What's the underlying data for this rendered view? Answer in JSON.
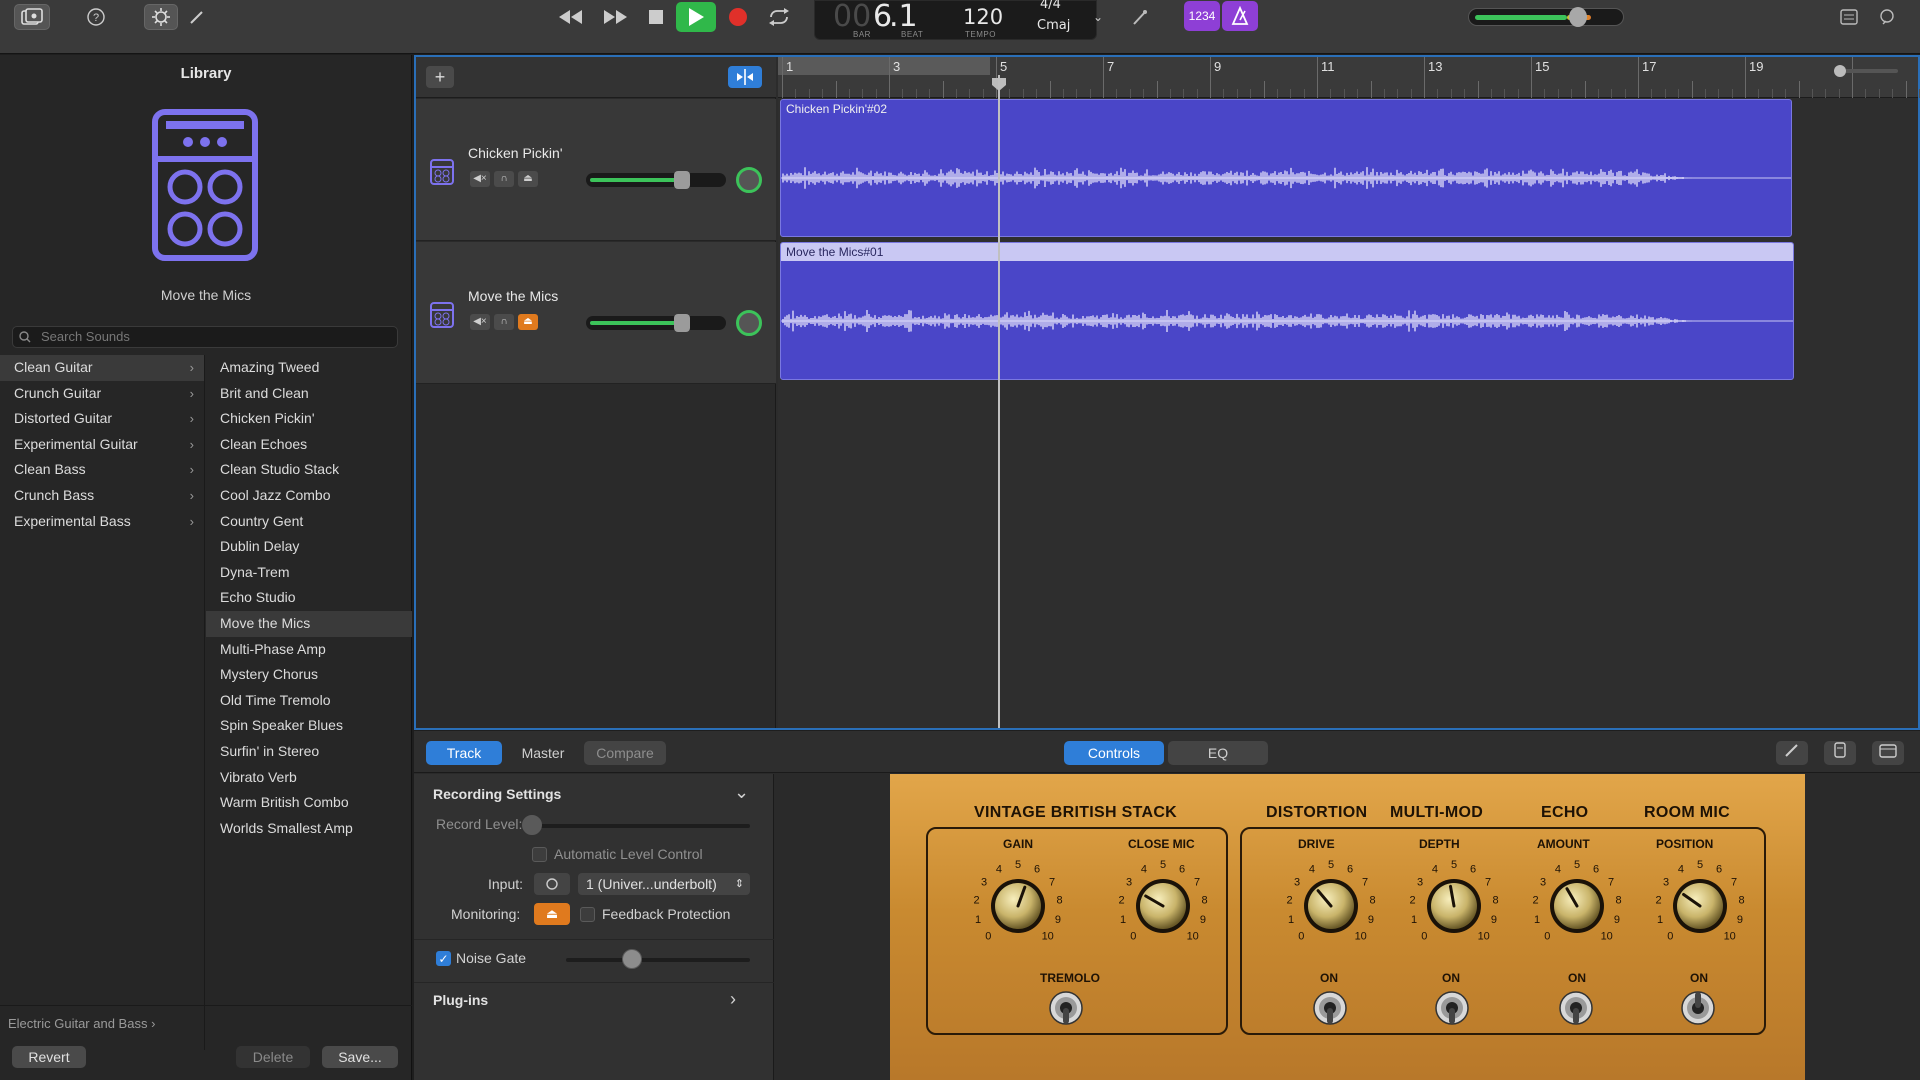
{
  "toolbar": {
    "lcd": {
      "bar": "6",
      "beat": ".1",
      "bar_prefix": "00",
      "bar_label": "BAR",
      "beat_label": "BEAT",
      "tempo": "120",
      "tempo_label": "TEMPO",
      "signature": "4/4",
      "key": "Cmaj"
    },
    "count_in": "1234",
    "master_volume": 0.68,
    "colors": {
      "play": "#30b84a",
      "record": "#e0302a",
      "purple": "#8e3fd6"
    }
  },
  "library": {
    "title": "Library",
    "selected_patch": "Move the Mics",
    "search_placeholder": "Search Sounds",
    "categories": [
      {
        "label": "Clean Guitar",
        "selected": true
      },
      {
        "label": "Crunch Guitar"
      },
      {
        "label": "Distorted Guitar"
      },
      {
        "label": "Experimental Guitar"
      },
      {
        "label": "Clean Bass"
      },
      {
        "label": "Crunch Bass"
      },
      {
        "label": "Experimental Bass"
      }
    ],
    "patches": [
      "Amazing Tweed",
      "Brit and Clean",
      "Chicken Pickin'",
      "Clean Echoes",
      "Clean Studio Stack",
      "Cool Jazz Combo",
      "Country Gent",
      "Dublin Delay",
      "Dyna-Trem",
      "Echo Studio",
      "Move the Mics",
      "Multi-Phase Amp",
      "Mystery Chorus",
      "Old Time Tremolo",
      "Spin Speaker Blues",
      "Surfin' in Stereo",
      "Vibrato Verb",
      "Warm British Combo",
      "Worlds Smallest Amp"
    ],
    "footer": {
      "breadcrumb": "Electric Guitar and Bass",
      "revert": "Revert",
      "delete": "Delete",
      "save": "Save..."
    }
  },
  "tracks": [
    {
      "name": "Chicken Pickin'",
      "volume": 0.72,
      "region": "Chicken Pickin'#02"
    },
    {
      "name": "Move the Mics",
      "volume": 0.72,
      "region": "Move the Mics#01"
    }
  ],
  "ruler": {
    "bars": [
      "1",
      "3",
      "5",
      "7",
      "9",
      "11",
      "13",
      "15",
      "17",
      "19"
    ]
  },
  "smart_controls": {
    "tabs_left": [
      "Track",
      "Master",
      "Compare"
    ],
    "tabs_center": [
      "Controls",
      "EQ"
    ],
    "recording": {
      "title": "Recording Settings",
      "record_level": "Record Level:",
      "auto_level": "Automatic Level Control",
      "input_label": "Input:",
      "input_value": "1 (Univer...underbolt)",
      "monitoring": "Monitoring:",
      "feedback": "Feedback Protection",
      "noise_gate": "Noise Gate",
      "plugins": "Plug-ins"
    },
    "amp": {
      "section_a": "VINTAGE BRITISH STACK",
      "gain": "GAIN",
      "close_mic": "CLOSE MIC",
      "tremolo": "TREMOLO",
      "distortion": "DISTORTION",
      "multimod": "MULTI-MOD",
      "echo": "ECHO",
      "room_mic": "ROOM MIC",
      "drive": "DRIVE",
      "depth": "DEPTH",
      "amount": "AMOUNT",
      "position": "POSITION",
      "on": "ON",
      "scale": [
        "0",
        "1",
        "2",
        "3",
        "4",
        "5",
        "6",
        "7",
        "8",
        "9",
        "10"
      ]
    }
  }
}
